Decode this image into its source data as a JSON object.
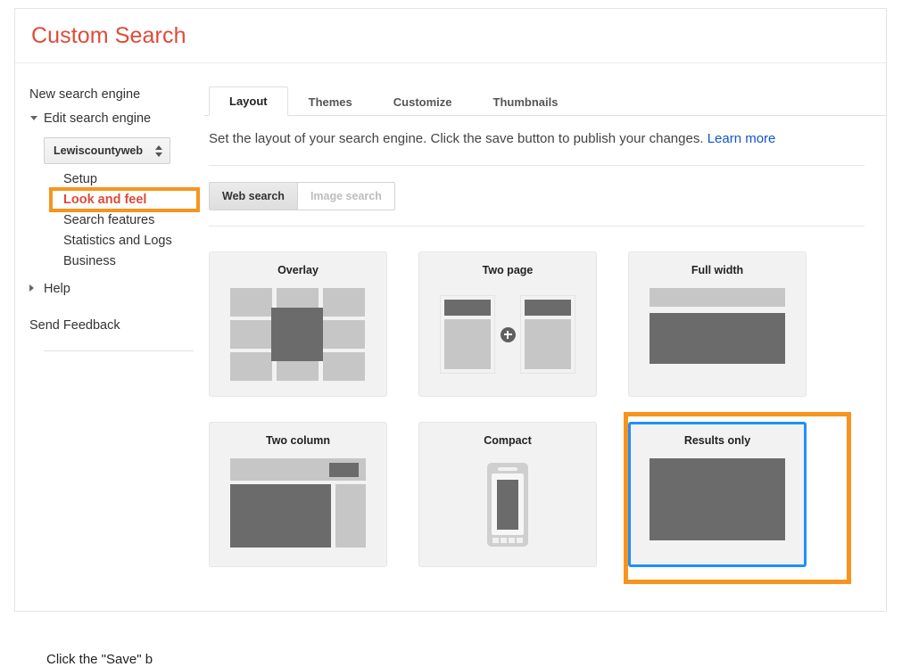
{
  "header": {
    "title": "Custom Search"
  },
  "sidebar": {
    "new_search_engine": "New search engine",
    "edit_search_engine": "Edit search engine",
    "engine_select": {
      "value": "Lewiscountyweb"
    },
    "sub_items": [
      {
        "label": "Setup",
        "active": false
      },
      {
        "label": "Look and feel",
        "active": true
      },
      {
        "label": "Search features",
        "active": false
      },
      {
        "label": "Statistics and Logs",
        "active": false
      },
      {
        "label": "Business",
        "active": false
      }
    ],
    "help": "Help",
    "send_feedback": "Send Feedback"
  },
  "main": {
    "tabs": [
      {
        "label": "Layout",
        "active": true
      },
      {
        "label": "Themes",
        "active": false
      },
      {
        "label": "Customize",
        "active": false
      },
      {
        "label": "Thumbnails",
        "active": false
      }
    ],
    "description": "Set the layout of your search engine. Click the save button to publish your changes.",
    "learn_more": "Learn more",
    "search_type_toggle": [
      {
        "label": "Web search",
        "active": true,
        "disabled": false
      },
      {
        "label": "Image search",
        "active": false,
        "disabled": true
      }
    ],
    "layouts": [
      {
        "id": "overlay",
        "label": "Overlay",
        "selected": false
      },
      {
        "id": "two-page",
        "label": "Two page",
        "selected": false
      },
      {
        "id": "full-width",
        "label": "Full width",
        "selected": false
      },
      {
        "id": "two-column",
        "label": "Two column",
        "selected": false
      },
      {
        "id": "compact",
        "label": "Compact",
        "selected": false
      },
      {
        "id": "results-only",
        "label": "Results only",
        "selected": true
      }
    ]
  },
  "footer": {
    "note": "Click the \"Save\" b"
  },
  "colors": {
    "brand_red": "#dd4b39",
    "annotation_orange": "#f7941e",
    "selection_blue": "#1e90ff",
    "link_blue": "#1155cc",
    "block_light": "#c6c6c6",
    "block_dark": "#6b6b6b",
    "card_bg": "#f2f2f2"
  }
}
